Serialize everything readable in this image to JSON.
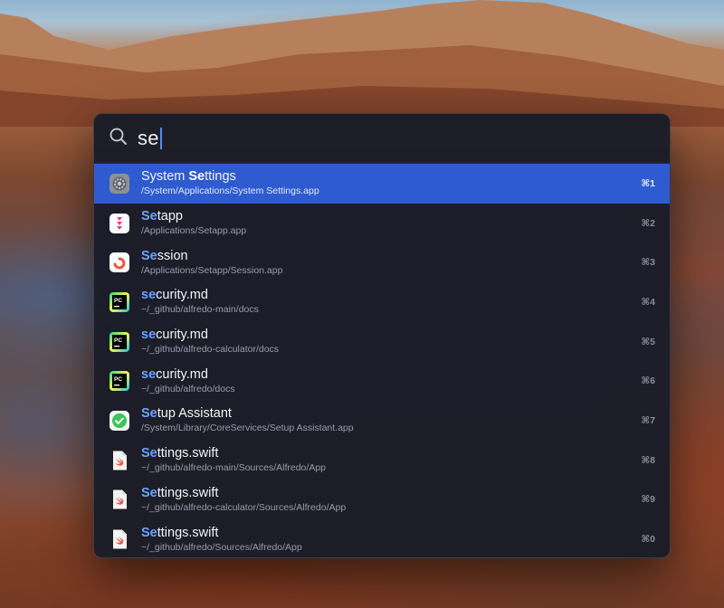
{
  "search": {
    "query": "se"
  },
  "results": [
    {
      "title_match": "Se",
      "title_rest": "ttings",
      "title_prefix": "System ",
      "subtitle": "/System/Applications/System Settings.app",
      "shortcut": "⌘1",
      "icon": "system-settings-icon",
      "selected": true
    },
    {
      "title_prefix": "",
      "title_match": "Se",
      "title_rest": "tapp",
      "subtitle": "/Applications/Setapp.app",
      "shortcut": "⌘2",
      "icon": "setapp-icon",
      "selected": false
    },
    {
      "title_prefix": "",
      "title_match": "Se",
      "title_rest": "ssion",
      "subtitle": "/Applications/Setapp/Session.app",
      "shortcut": "⌘3",
      "icon": "session-icon",
      "selected": false
    },
    {
      "title_prefix": "",
      "title_match": "se",
      "title_rest": "curity.md",
      "subtitle": "~/_github/alfredo-main/docs",
      "shortcut": "⌘4",
      "icon": "pycharm-icon",
      "selected": false
    },
    {
      "title_prefix": "",
      "title_match": "se",
      "title_rest": "curity.md",
      "subtitle": "~/_github/alfredo-calculator/docs",
      "shortcut": "⌘5",
      "icon": "pycharm-icon",
      "selected": false
    },
    {
      "title_prefix": "",
      "title_match": "se",
      "title_rest": "curity.md",
      "subtitle": "~/_github/alfredo/docs",
      "shortcut": "⌘6",
      "icon": "pycharm-icon",
      "selected": false
    },
    {
      "title_prefix": "",
      "title_match": "Se",
      "title_rest": "tup Assistant",
      "subtitle": "/System/Library/CoreServices/Setup Assistant.app",
      "shortcut": "⌘7",
      "icon": "setup-assistant-icon",
      "selected": false
    },
    {
      "title_prefix": "",
      "title_match": "Se",
      "title_rest": "ttings.swift",
      "subtitle": "~/_github/alfredo-main/Sources/Alfredo/App",
      "shortcut": "⌘8",
      "icon": "swift-file-icon",
      "selected": false
    },
    {
      "title_prefix": "",
      "title_match": "Se",
      "title_rest": "ttings.swift",
      "subtitle": "~/_github/alfredo-calculator/Sources/Alfredo/App",
      "shortcut": "⌘9",
      "icon": "swift-file-icon",
      "selected": false
    },
    {
      "title_prefix": "",
      "title_match": "Se",
      "title_rest": "ttings.swift",
      "subtitle": "~/_github/alfredo/Sources/Alfredo/App",
      "shortcut": "⌘0",
      "icon": "swift-file-icon",
      "selected": false
    }
  ],
  "colors": {
    "selection": "#2f5bd0",
    "highlight": "#6aa4ff",
    "panel": "#1a1c28"
  }
}
